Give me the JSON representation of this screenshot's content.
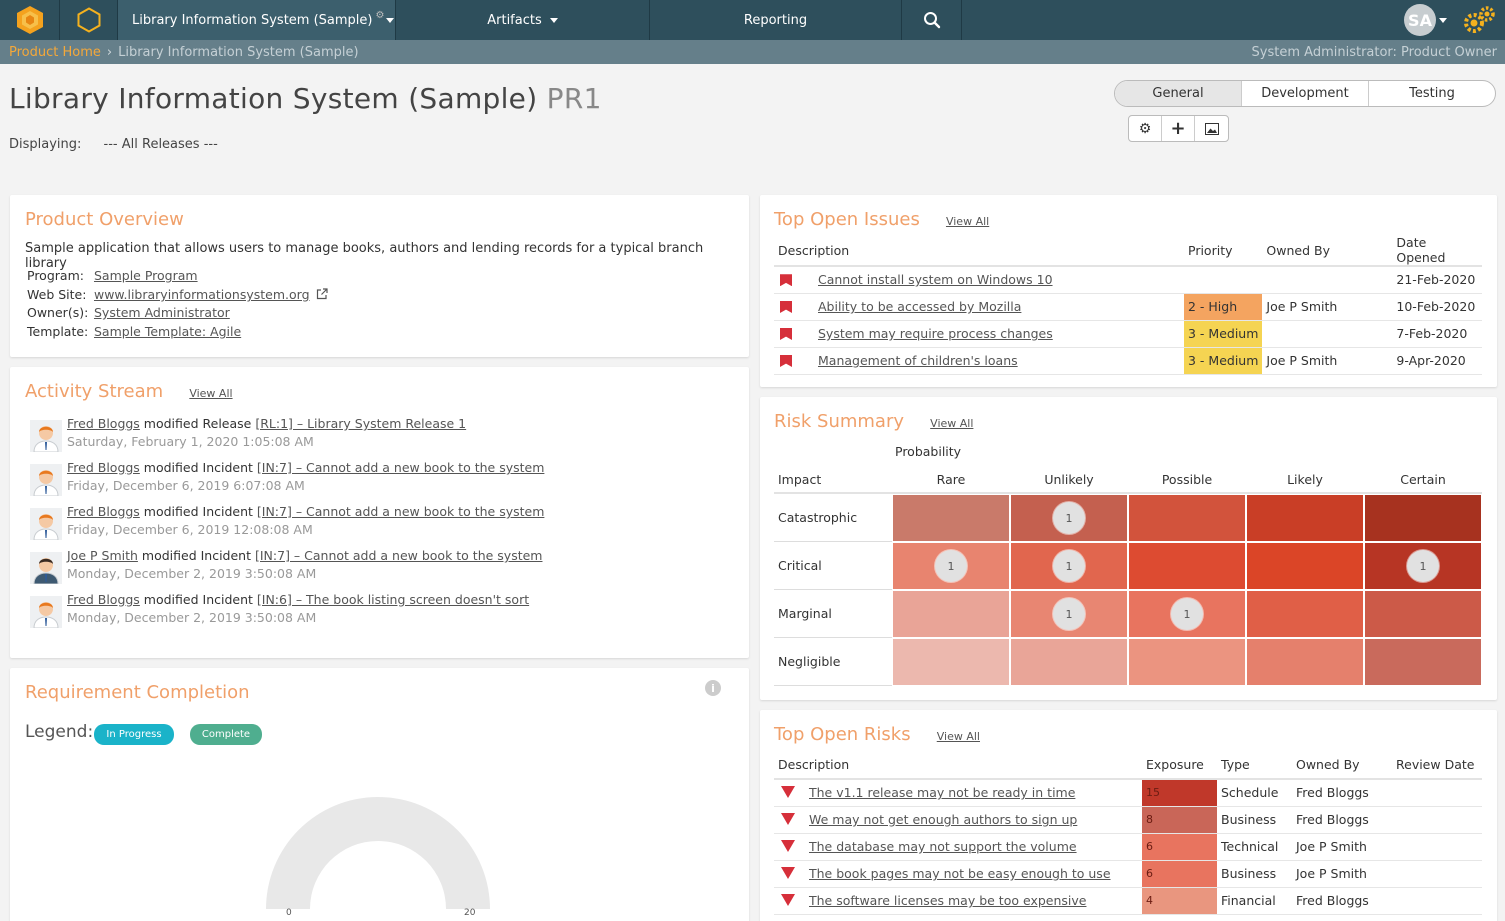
{
  "nav": {
    "product": "Library Information System (Sample)",
    "artifacts": "Artifacts",
    "reporting": "Reporting",
    "user_initials": "SA"
  },
  "breadcrumb": {
    "home": "Product Home",
    "current": "Library Information System (Sample)",
    "role": "System Administrator: Product Owner"
  },
  "header": {
    "title": "Library Information System (Sample)",
    "code": "PR1",
    "displaying_label": "Displaying:",
    "displaying_value": "--- All Releases ---"
  },
  "tabs": [
    "General",
    "Development",
    "Testing"
  ],
  "overview": {
    "title": "Product Overview",
    "description": "Sample application that allows users to manage books, authors and lending records for a typical branch library",
    "program_label": "Program:",
    "program": "Sample Program",
    "website_label": "Web Site:",
    "website": "www.libraryinformationsystem.org",
    "owners_label": "Owner(s):",
    "owners": "System Administrator",
    "template_label": "Template:",
    "template": "Sample Template: Agile"
  },
  "activity": {
    "title": "Activity Stream",
    "view_all": "View All",
    "items": [
      {
        "user": "Fred Bloggs",
        "action": "modified Release",
        "link": "[RL:1] – Library System Release 1",
        "date": "Saturday, February 1, 2020 1:05:08 AM"
      },
      {
        "user": "Fred Bloggs",
        "action": "modified Incident",
        "link": "[IN:7] – Cannot add a new book to the system",
        "date": "Friday, December 6, 2019 6:07:08 AM"
      },
      {
        "user": "Fred Bloggs",
        "action": "modified Incident",
        "link": "[IN:7] – Cannot add a new book to the system",
        "date": "Friday, December 6, 2019 12:08:08 AM"
      },
      {
        "user": "Joe P Smith",
        "action": "modified Incident",
        "link": "[IN:7] – Cannot add a new book to the system",
        "date": "Monday, December 2, 2019 3:50:08 AM"
      },
      {
        "user": "Fred Bloggs",
        "action": "modified Incident",
        "link": "[IN:6] – The book listing screen doesn't sort",
        "date": "Monday, December 2, 2019 3:50:08 AM"
      }
    ]
  },
  "requirements": {
    "title": "Requirement Completion",
    "legend_label": "Legend:",
    "legend_in_progress": "In Progress",
    "legend_complete": "Complete",
    "gauge_min": "0",
    "gauge_max": "20"
  },
  "issues": {
    "title": "Top Open Issues",
    "view_all": "View All",
    "headers": [
      "Description",
      "Priority",
      "Owned By",
      "Date Opened"
    ],
    "rows": [
      {
        "desc": "Cannot install system on Windows 10",
        "priority": "",
        "priority_color": "",
        "owner": "",
        "date": "21-Feb-2020"
      },
      {
        "desc": "Ability to be accessed by Mozilla",
        "priority": "2 - High",
        "priority_color": "#f4a460",
        "owner": "Joe P Smith",
        "date": "10-Feb-2020"
      },
      {
        "desc": "System may require process changes",
        "priority": "3 - Medium",
        "priority_color": "#f5d452",
        "owner": "",
        "date": "7-Feb-2020"
      },
      {
        "desc": "Management of children's loans",
        "priority": "3 - Medium",
        "priority_color": "#f5d452",
        "owner": "Joe P Smith",
        "date": "9-Apr-2020"
      }
    ]
  },
  "risk_summary": {
    "title": "Risk Summary",
    "view_all": "View All",
    "probability_label": "Probability",
    "impact_label": "Impact",
    "columns": [
      "Rare",
      "Unlikely",
      "Possible",
      "Likely",
      "Certain"
    ],
    "rows": [
      {
        "label": "Catastrophic",
        "colors": [
          "#c97a6a",
          "#c4604f",
          "#d2533c",
          "#c93e26",
          "#a7321f"
        ],
        "counts": [
          "",
          "1",
          "",
          "",
          ""
        ]
      },
      {
        "label": "Critical",
        "colors": [
          "#e8846f",
          "#e1664e",
          "#dd4b31",
          "#db4527",
          "#b73524"
        ],
        "counts": [
          "1",
          "1",
          "",
          "",
          "1"
        ]
      },
      {
        "label": "Marginal",
        "colors": [
          "#e9a497",
          "#e88672",
          "#e8745f",
          "#e05f47",
          "#cc5a48"
        ],
        "counts": [
          "",
          "1",
          "1",
          "",
          ""
        ]
      },
      {
        "label": "Negligible",
        "colors": [
          "#ecb8ae",
          "#e9a598",
          "#eb9480",
          "#e5806c",
          "#c96a5c"
        ],
        "counts": [
          "",
          "",
          "",
          "",
          ""
        ]
      }
    ]
  },
  "risks": {
    "title": "Top Open Risks",
    "view_all": "View All",
    "headers": [
      "Description",
      "Exposure",
      "Type",
      "Owned By",
      "Review Date"
    ],
    "rows": [
      {
        "desc": "The v1.1 release may not be ready in time",
        "exposure": "15",
        "exposure_color": "#c0382a",
        "type": "Schedule",
        "owner": "Fred Bloggs",
        "review": ""
      },
      {
        "desc": "We may not get enough authors to sign up",
        "exposure": "8",
        "exposure_color": "#c96658",
        "type": "Business",
        "owner": "Fred Bloggs",
        "review": ""
      },
      {
        "desc": "The database may not support the volume",
        "exposure": "6",
        "exposure_color": "#e8745f",
        "type": "Technical",
        "owner": "Joe P Smith",
        "review": ""
      },
      {
        "desc": "The book pages may not be easy enough to use",
        "exposure": "6",
        "exposure_color": "#e8745f",
        "type": "Business",
        "owner": "Joe P Smith",
        "review": ""
      },
      {
        "desc": "The software licenses may be too expensive",
        "exposure": "4",
        "exposure_color": "#e9967f",
        "type": "Financial",
        "owner": "Fred Bloggs",
        "review": ""
      }
    ]
  }
}
